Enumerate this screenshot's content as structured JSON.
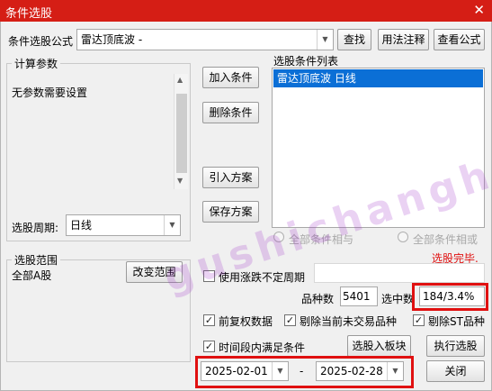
{
  "window": {
    "title": "条件选股",
    "close_glyph": "✕"
  },
  "formula": {
    "label": "条件选股公式",
    "value": "雷达顶底波  -",
    "find_button": "查找",
    "usage_button": "用法注释",
    "view_button": "查看公式"
  },
  "params": {
    "group_label": "计算参数",
    "no_params_text": "无参数需要设置",
    "period_label": "选股周期:",
    "period_value": "日线"
  },
  "actions": {
    "add_condition": "加入条件",
    "remove_condition": "删除条件",
    "import_scheme": "引入方案",
    "save_scheme": "保存方案"
  },
  "condition_list": {
    "label": "选股条件列表",
    "items": [
      "雷达顶底波  日线"
    ]
  },
  "logic": {
    "and_label": "全部条件相与",
    "or_label": "全部条件相或"
  },
  "status": {
    "text": "选股完毕.",
    "color": "#e01010"
  },
  "range": {
    "group_label": "选股范围",
    "value": "全部A股",
    "change_button": "改变范围"
  },
  "options": {
    "variable_period_label": "使用涨跌不定周期",
    "variable_period_checked": false,
    "stock_count_label": "品种数",
    "stock_count_value": "5401",
    "selected_label": "选中数",
    "selected_value": "184/3.4%",
    "pre_adjust_label": "前复权数据",
    "pre_adjust_checked": true,
    "exclude_no_trade_label": "剔除当前未交易品种",
    "exclude_no_trade_checked": true,
    "exclude_st_label": "剔除ST品种",
    "exclude_st_checked": true,
    "time_range_label": "时间段内满足条件",
    "time_range_checked": true,
    "check_glyph": "✓"
  },
  "bottom": {
    "to_block_button": "选股入板块",
    "execute_button": "执行选股",
    "close_button": "关闭",
    "start_date": "2025-02-01",
    "date_separator": "-",
    "end_date": "2025-02-28"
  },
  "watermark": {
    "text": "gushichanghong.com"
  },
  "icons": {
    "dropdown": "▼",
    "scroll_up": "▲",
    "scroll_down": "▼"
  },
  "colors": {
    "title_bar": "#d51e15",
    "selection": "#0b6fd6",
    "highlight_box": "#e01010"
  }
}
